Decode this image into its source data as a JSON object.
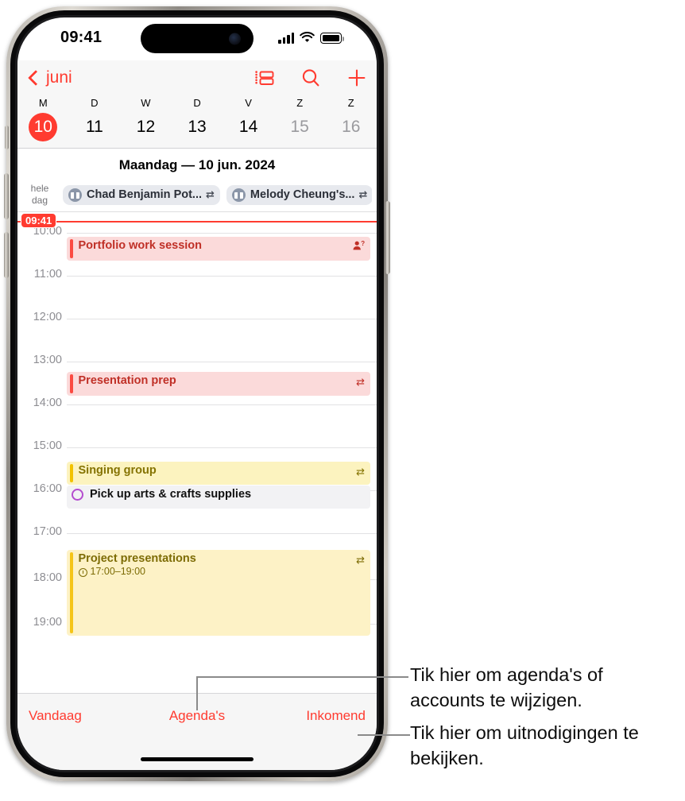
{
  "status_bar": {
    "time": "09:41",
    "signal_icon": "cellular-bars-icon",
    "wifi_icon": "wifi-icon",
    "battery_icon": "battery-icon"
  },
  "nav": {
    "back_label": "juni",
    "back_icon": "chevron-left-icon",
    "actions": [
      {
        "name": "list-view-icon",
        "label": "Lijstweergave"
      },
      {
        "name": "search-icon",
        "label": "Zoeken"
      },
      {
        "name": "plus-icon",
        "label": "Nieuw"
      }
    ]
  },
  "week_strip": {
    "weekday_initials": [
      "M",
      "D",
      "W",
      "D",
      "V",
      "Z",
      "Z"
    ],
    "days": [
      {
        "num": "10",
        "selected": true,
        "muted": false
      },
      {
        "num": "11",
        "selected": false,
        "muted": false
      },
      {
        "num": "12",
        "selected": false,
        "muted": false
      },
      {
        "num": "13",
        "selected": false,
        "muted": false
      },
      {
        "num": "14",
        "selected": false,
        "muted": false
      },
      {
        "num": "15",
        "selected": false,
        "muted": true
      },
      {
        "num": "16",
        "selected": false,
        "muted": true
      }
    ],
    "selected_color": "#ff3b30"
  },
  "day_title": "Maandag — 10 jun. 2024",
  "all_day": {
    "label_line1": "hele",
    "label_line2": "dag",
    "chips": [
      {
        "title": "Chad Benjamin Pot...",
        "icon": "gift-icon",
        "repeat_icon": "repeat-icon"
      },
      {
        "title": "Melody Cheung's...",
        "icon": "gift-icon",
        "repeat_icon": "repeat-icon"
      }
    ]
  },
  "timeline": {
    "now_label": "09:41",
    "now_color": "#ff3b30",
    "hours": [
      "10:00",
      "11:00",
      "12:00",
      "13:00",
      "14:00",
      "15:00",
      "16:00",
      "17:00",
      "18:00",
      "19:00"
    ],
    "events": [
      {
        "title": "Portfolio work session",
        "subtitle": "",
        "icon": "person-question-icon",
        "color": "#fb4b42"
      },
      {
        "title": "Presentation prep",
        "subtitle": "",
        "icon": "repeat-icon",
        "color": "#fb4b42"
      },
      {
        "title": "Singing group",
        "subtitle": "",
        "icon": "repeat-icon",
        "color": "#f2c200"
      },
      {
        "title": "Pick up arts & crafts supplies",
        "subtitle": "",
        "icon": "reminder-circle-icon",
        "color": "#b44ccf"
      },
      {
        "title": "Project presentations",
        "subtitle": "17:00–19:00",
        "icon": "repeat-icon",
        "color": "#f5c518"
      }
    ]
  },
  "toolbar": {
    "today_label": "Vandaag",
    "calendars_label": "Agenda's",
    "inbox_label": "Inkomend",
    "tint": "#ff3b30"
  },
  "callouts": [
    {
      "text": "Tik hier om agenda's of accounts te wijzigen."
    },
    {
      "text": "Tik hier om uitnodigingen te bekijken."
    }
  ]
}
